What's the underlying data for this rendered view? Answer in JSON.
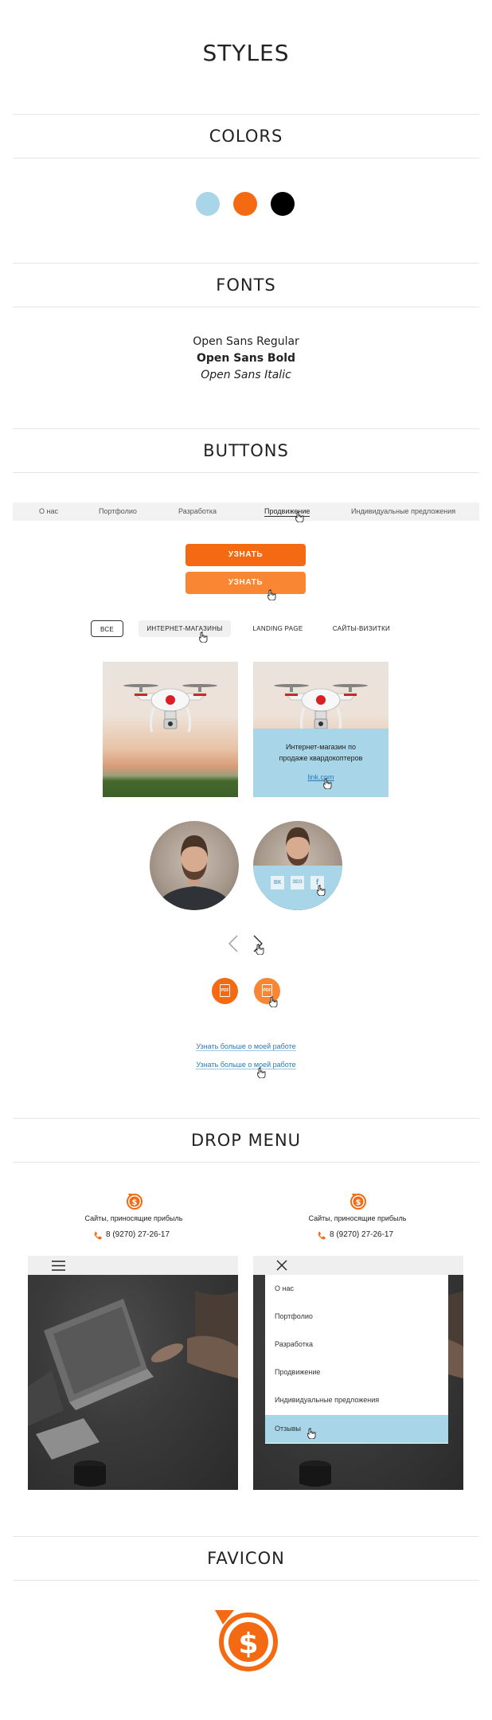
{
  "page_title": "STYLES",
  "sections": {
    "colors": "COLORS",
    "fonts": "FONTS",
    "buttons": "BUTTONS",
    "drop_menu": "DROP MENU",
    "favicon": "FAVICON"
  },
  "colors": [
    "#a9d5e8",
    "#f46a12",
    "#000000"
  ],
  "fonts": {
    "regular": "Open Sans Regular",
    "bold": "Open Sans Bold",
    "italic": "Open Sans Italic"
  },
  "nav": {
    "items": [
      "О нас",
      "Портфолио",
      "Разработка",
      "Продвижение",
      "Индивидуальные предложения"
    ],
    "active_index": 3
  },
  "buttons": {
    "cta_label": "УЗНАТЬ",
    "cta_color": "#f46a12",
    "cta_hover_color": "#f88633"
  },
  "filters": [
    "ВСЕ",
    "ИНТЕРНЕТ-МАГАЗИНЫ",
    "LANDING PAGE",
    "САЙТЫ-ВИЗИТКИ"
  ],
  "portfolio_card": {
    "title": "Интернет-магазин по продаже квардокоптеров",
    "link": "link.com"
  },
  "social": [
    "ВК",
    "ЗЕО",
    "f"
  ],
  "pdf_label": "PDF",
  "more_link": "Узнать больше о моей работе",
  "header_block": {
    "tagline": "Сайты, приносящие прибыль",
    "phone": "8 (9270) 27-26-17",
    "logo_symbol": "$"
  },
  "drop_menu_items": [
    "О нас",
    "Портфолио",
    "Разработка",
    "Продвижение",
    "Индивидуальные предложения",
    "Отзывы"
  ],
  "drop_menu_active": 5
}
